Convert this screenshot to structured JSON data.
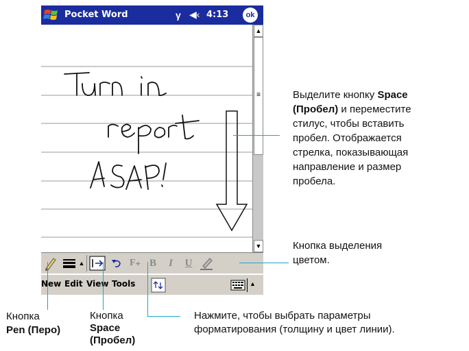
{
  "titlebar": {
    "app_title": "Pocket Word",
    "time": "4:13",
    "ok_label": "ok"
  },
  "document": {
    "handwriting": [
      "Turn in",
      "report",
      "ASAP!"
    ]
  },
  "pen_toolbar": {
    "format_bold": "B",
    "format_italic": "I",
    "format_underline": "U"
  },
  "menubar": {
    "items": [
      "New",
      "Edit",
      "View",
      "Tools"
    ]
  },
  "callouts": {
    "space_desc": {
      "line1_pre": "Выделите кнопку ",
      "line1_bold": "Space",
      "line2_bold": "(Пробел)",
      "line2_rest": " и переместите",
      "line3": "стилус, чтобы вставить",
      "line4": "пробел. Отображается",
      "line5": "стрелка, показывающая",
      "line6": "направление и размер",
      "line7": "пробела."
    },
    "highlight": {
      "line1": "Кнопка выделения",
      "line2": "цветом."
    },
    "pen": {
      "line1": "Кнопка",
      "line2": "Pen (Перо)"
    },
    "space": {
      "line1": "Кнопка",
      "line2": "Space",
      "line3": "(Пробел)"
    },
    "format": {
      "line1": "Нажмите, чтобы выбрать параметры",
      "line2": "форматирования (толщину и цвет линии)."
    }
  },
  "colors": {
    "titlebar": "#1a2c9e",
    "callout_line": "#19a6c9",
    "toolbar": "#d4d0c8"
  }
}
